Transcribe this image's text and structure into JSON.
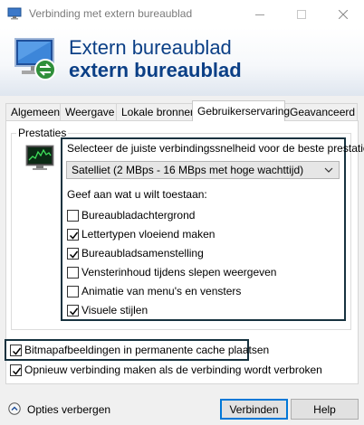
{
  "window": {
    "title": "Verbinding met extern bureaublad",
    "banner_line1": "Extern bureaublad",
    "banner_line2": "extern bureaublad"
  },
  "tabs": [
    {
      "label": "Algemeen",
      "active": false
    },
    {
      "label": "Weergave",
      "active": false
    },
    {
      "label": "Lokale bronnen",
      "active": false
    },
    {
      "label": "Gebruikerservaring",
      "active": true
    },
    {
      "label": "Geavanceerd",
      "active": false
    }
  ],
  "performance": {
    "group_title": "Prestaties",
    "prompt": "Selecteer de juiste verbindingssnelheid voor de beste prestaties.",
    "speed_selected": "Satelliet (2 MBps - 16 MBps met hoge wachttijd)",
    "allow_label": "Geef aan wat u wilt toestaan:",
    "options": [
      {
        "label": "Bureaubladachtergrond",
        "checked": false
      },
      {
        "label": "Lettertypen vloeiend maken",
        "checked": true
      },
      {
        "label": "Bureaubladsamenstelling",
        "checked": true
      },
      {
        "label": "Vensterinhoud tijdens slepen weergeven",
        "checked": false
      },
      {
        "label": "Animatie van menu's en vensters",
        "checked": false
      },
      {
        "label": "Visuele stijlen",
        "checked": true
      }
    ]
  },
  "persistent_cache": {
    "label": "Bitmapafbeeldingen in permanente cache plaatsen",
    "checked": true
  },
  "reconnect": {
    "label": "Opnieuw verbinding maken als de verbinding wordt verbroken",
    "checked": true
  },
  "footer": {
    "options_toggle": "Opties verbergen",
    "connect_button": "Verbinden",
    "help_button": "Help"
  },
  "colors": {
    "accent": "#0078d7",
    "banner_text": "#0b3f86",
    "highlight_border": "#17323f"
  }
}
